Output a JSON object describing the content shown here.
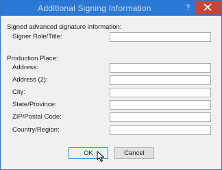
{
  "dialog": {
    "title": "Additional Signing Information",
    "help_label": "?",
    "close_icon": "close-icon",
    "colors": {
      "titlebar": "#2b79d6",
      "close": "#c7463c",
      "accent": "#2f7fd6"
    }
  },
  "signer_section": {
    "heading": "Signed advanced signature information:",
    "role_label": "Signer Role/Title:",
    "role_value": ""
  },
  "place_section": {
    "heading": "Production Place:",
    "fields": [
      {
        "label": "Address:",
        "value": ""
      },
      {
        "label": "Address (2):",
        "value": ""
      },
      {
        "label": "City:",
        "value": ""
      },
      {
        "label": "State/Province:",
        "value": ""
      },
      {
        "label": "ZIP/Postal Code:",
        "value": ""
      },
      {
        "label": "Country/Region:",
        "value": ""
      }
    ]
  },
  "buttons": {
    "ok": "OK",
    "cancel": "Cancel"
  }
}
